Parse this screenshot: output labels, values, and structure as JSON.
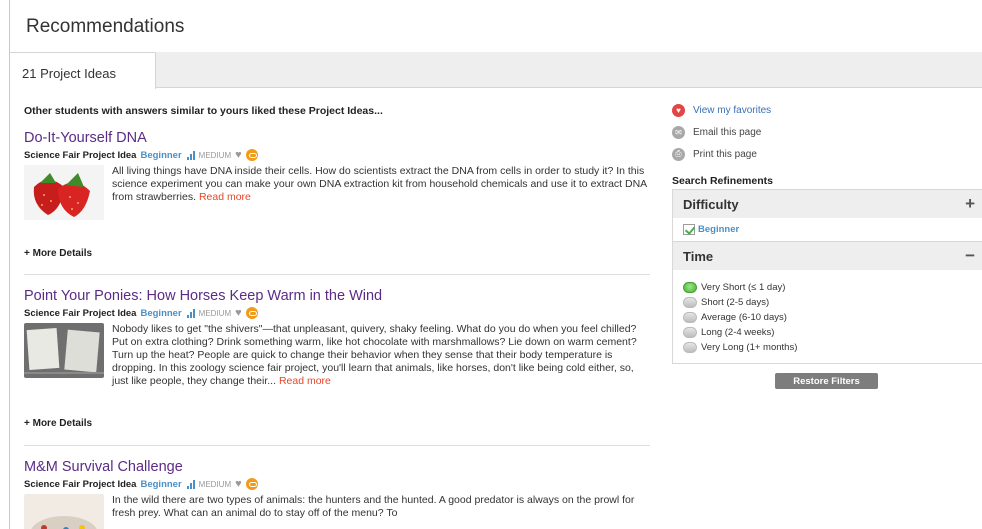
{
  "page": {
    "title": "Recommendations"
  },
  "tab": {
    "label": "21 Project Ideas"
  },
  "intro": "Other students with answers similar to yours liked these Project Ideas...",
  "projects": [
    {
      "title": "Do-It-Yourself DNA",
      "kind": "Science Fair Project Idea",
      "level": "Beginner",
      "cost": "MEDIUM",
      "description": "All living things have DNA inside their cells. How do scientists extract the DNA from cells in order to study it? In this science experiment you can make your own DNA extraction kit from household chemicals and use it to extract DNA from strawberries.",
      "read_more": "Read more",
      "details": "+ More Details"
    },
    {
      "title": "Point Your Ponies: How Horses Keep Warm in the Wind",
      "kind": "Science Fair Project Idea",
      "level": "Beginner",
      "cost": "MEDIUM",
      "description": "Nobody likes to get \"the shivers\"—that unpleasant, quivery, shaky feeling. What do you do when you feel chilled? Put on extra clothing? Drink something warm, like hot chocolate with marshmallows? Lie down on warm cement? Turn up the heat? People are quick to change their behavior when they sense that their body temperature is dropping. In this zoology science fair project, you'll learn that animals, like horses, don't like being cold either, so, just like people, they change their...",
      "read_more": "Read more",
      "details": "+ More Details"
    },
    {
      "title": "M&M Survival Challenge",
      "kind": "Science Fair Project Idea",
      "level": "Beginner",
      "cost": "MEDIUM",
      "description": "In the wild there are two types of animals: the hunters and the hunted. A good predator is always on the prowl for fresh prey. What can an animal do to stay off of the menu? To",
      "read_more": "",
      "details": ""
    }
  ],
  "sidebar": {
    "favorites": "View my favorites",
    "email": "Email this page",
    "print": "Print this page",
    "refinements_heading": "Search Refinements",
    "difficulty": {
      "title": "Difficulty",
      "toggle": "+",
      "checked": "Beginner"
    },
    "time": {
      "title": "Time",
      "toggle": "−",
      "options": [
        "Very Short (≤ 1 day)",
        "Short (2-5 days)",
        "Average (6-10 days)",
        "Long (2-4 weeks)",
        "Very Long (1+ months)"
      ],
      "selected_index": 0
    },
    "restore_button": "Restore Filters"
  },
  "colors": {
    "title_purple": "#5b2b86",
    "level_blue": "#4a90c8",
    "read_more_red": "#e4472a",
    "favorite_red": "#e24545"
  }
}
